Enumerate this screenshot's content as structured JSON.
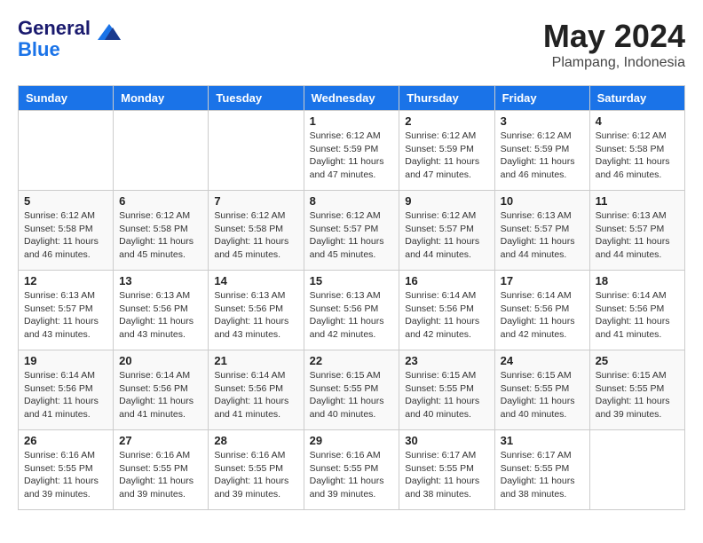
{
  "header": {
    "logo_line1": "General",
    "logo_line2": "Blue",
    "month_year": "May 2024",
    "location": "Plampang, Indonesia"
  },
  "weekdays": [
    "Sunday",
    "Monday",
    "Tuesday",
    "Wednesday",
    "Thursday",
    "Friday",
    "Saturday"
  ],
  "weeks": [
    [
      {
        "day": "",
        "info": ""
      },
      {
        "day": "",
        "info": ""
      },
      {
        "day": "",
        "info": ""
      },
      {
        "day": "1",
        "info": "Sunrise: 6:12 AM\nSunset: 5:59 PM\nDaylight: 11 hours\nand 47 minutes."
      },
      {
        "day": "2",
        "info": "Sunrise: 6:12 AM\nSunset: 5:59 PM\nDaylight: 11 hours\nand 47 minutes."
      },
      {
        "day": "3",
        "info": "Sunrise: 6:12 AM\nSunset: 5:59 PM\nDaylight: 11 hours\nand 46 minutes."
      },
      {
        "day": "4",
        "info": "Sunrise: 6:12 AM\nSunset: 5:58 PM\nDaylight: 11 hours\nand 46 minutes."
      }
    ],
    [
      {
        "day": "5",
        "info": "Sunrise: 6:12 AM\nSunset: 5:58 PM\nDaylight: 11 hours\nand 46 minutes."
      },
      {
        "day": "6",
        "info": "Sunrise: 6:12 AM\nSunset: 5:58 PM\nDaylight: 11 hours\nand 45 minutes."
      },
      {
        "day": "7",
        "info": "Sunrise: 6:12 AM\nSunset: 5:58 PM\nDaylight: 11 hours\nand 45 minutes."
      },
      {
        "day": "8",
        "info": "Sunrise: 6:12 AM\nSunset: 5:57 PM\nDaylight: 11 hours\nand 45 minutes."
      },
      {
        "day": "9",
        "info": "Sunrise: 6:12 AM\nSunset: 5:57 PM\nDaylight: 11 hours\nand 44 minutes."
      },
      {
        "day": "10",
        "info": "Sunrise: 6:13 AM\nSunset: 5:57 PM\nDaylight: 11 hours\nand 44 minutes."
      },
      {
        "day": "11",
        "info": "Sunrise: 6:13 AM\nSunset: 5:57 PM\nDaylight: 11 hours\nand 44 minutes."
      }
    ],
    [
      {
        "day": "12",
        "info": "Sunrise: 6:13 AM\nSunset: 5:57 PM\nDaylight: 11 hours\nand 43 minutes."
      },
      {
        "day": "13",
        "info": "Sunrise: 6:13 AM\nSunset: 5:56 PM\nDaylight: 11 hours\nand 43 minutes."
      },
      {
        "day": "14",
        "info": "Sunrise: 6:13 AM\nSunset: 5:56 PM\nDaylight: 11 hours\nand 43 minutes."
      },
      {
        "day": "15",
        "info": "Sunrise: 6:13 AM\nSunset: 5:56 PM\nDaylight: 11 hours\nand 42 minutes."
      },
      {
        "day": "16",
        "info": "Sunrise: 6:14 AM\nSunset: 5:56 PM\nDaylight: 11 hours\nand 42 minutes."
      },
      {
        "day": "17",
        "info": "Sunrise: 6:14 AM\nSunset: 5:56 PM\nDaylight: 11 hours\nand 42 minutes."
      },
      {
        "day": "18",
        "info": "Sunrise: 6:14 AM\nSunset: 5:56 PM\nDaylight: 11 hours\nand 41 minutes."
      }
    ],
    [
      {
        "day": "19",
        "info": "Sunrise: 6:14 AM\nSunset: 5:56 PM\nDaylight: 11 hours\nand 41 minutes."
      },
      {
        "day": "20",
        "info": "Sunrise: 6:14 AM\nSunset: 5:56 PM\nDaylight: 11 hours\nand 41 minutes."
      },
      {
        "day": "21",
        "info": "Sunrise: 6:14 AM\nSunset: 5:56 PM\nDaylight: 11 hours\nand 41 minutes."
      },
      {
        "day": "22",
        "info": "Sunrise: 6:15 AM\nSunset: 5:55 PM\nDaylight: 11 hours\nand 40 minutes."
      },
      {
        "day": "23",
        "info": "Sunrise: 6:15 AM\nSunset: 5:55 PM\nDaylight: 11 hours\nand 40 minutes."
      },
      {
        "day": "24",
        "info": "Sunrise: 6:15 AM\nSunset: 5:55 PM\nDaylight: 11 hours\nand 40 minutes."
      },
      {
        "day": "25",
        "info": "Sunrise: 6:15 AM\nSunset: 5:55 PM\nDaylight: 11 hours\nand 39 minutes."
      }
    ],
    [
      {
        "day": "26",
        "info": "Sunrise: 6:16 AM\nSunset: 5:55 PM\nDaylight: 11 hours\nand 39 minutes."
      },
      {
        "day": "27",
        "info": "Sunrise: 6:16 AM\nSunset: 5:55 PM\nDaylight: 11 hours\nand 39 minutes."
      },
      {
        "day": "28",
        "info": "Sunrise: 6:16 AM\nSunset: 5:55 PM\nDaylight: 11 hours\nand 39 minutes."
      },
      {
        "day": "29",
        "info": "Sunrise: 6:16 AM\nSunset: 5:55 PM\nDaylight: 11 hours\nand 39 minutes."
      },
      {
        "day": "30",
        "info": "Sunrise: 6:17 AM\nSunset: 5:55 PM\nDaylight: 11 hours\nand 38 minutes."
      },
      {
        "day": "31",
        "info": "Sunrise: 6:17 AM\nSunset: 5:55 PM\nDaylight: 11 hours\nand 38 minutes."
      },
      {
        "day": "",
        "info": ""
      }
    ]
  ]
}
